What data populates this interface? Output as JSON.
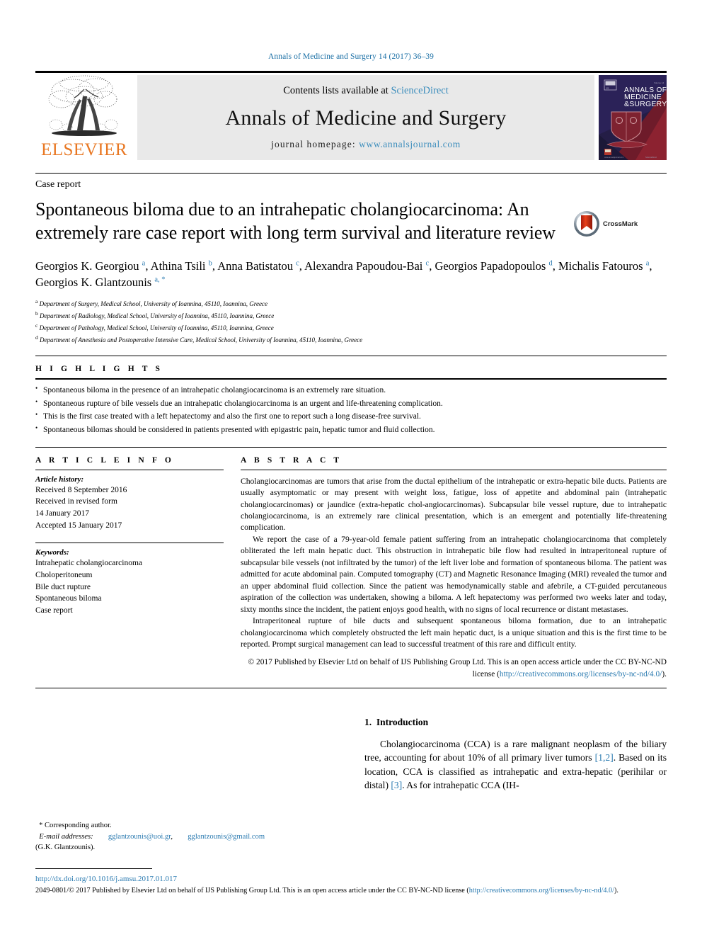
{
  "running_head": "Annals of Medicine and Surgery 14 (2017) 36–39",
  "banner": {
    "publisher_name": "ELSEVIER",
    "contents_prefix": "Contents lists available at ",
    "contents_link": "ScienceDirect",
    "journal_title": "Annals of Medicine and Surgery",
    "homepage_prefix": "journal homepage: ",
    "homepage_url": "www.annalsjournal.com",
    "cover_title_line1": "ANNALS OF",
    "cover_title_line2": "MEDICINE",
    "cover_title_line3": "&SURGERY"
  },
  "article": {
    "type": "Case report",
    "title": "Spontaneous biloma due to an intrahepatic cholangiocarcinoma: An extremely rare case report with long term survival and literature review",
    "crossmark_label": "CrossMark",
    "authors": [
      {
        "name": "Georgios K. Georgiou",
        "sup": "a",
        "sep": ", "
      },
      {
        "name": "Athina Tsili",
        "sup": "b",
        "sep": ", "
      },
      {
        "name": "Anna Batistatou",
        "sup": "c",
        "sep": ", "
      },
      {
        "name": "Alexandra Papoudou-Bai",
        "sup": "c",
        "sep": ", "
      },
      {
        "name": "Georgios Papadopoulos",
        "sup": "d",
        "sep": ", "
      },
      {
        "name": "Michalis Fatouros",
        "sup": "a",
        "sep": ", "
      },
      {
        "name": "Georgios K. Glantzounis",
        "sup": "a, *",
        "sep": ""
      }
    ],
    "affiliations": [
      {
        "mark": "a",
        "text": "Department of Surgery, Medical School, University of Ioannina, 45110, Ioannina, Greece"
      },
      {
        "mark": "b",
        "text": "Department of Radiology, Medical School, University of Ioannina, 45110, Ioannina, Greece"
      },
      {
        "mark": "c",
        "text": "Department of Pathology, Medical School, University of Ioannina, 45110, Ioannina, Greece"
      },
      {
        "mark": "d",
        "text": "Department of Anesthesia and Postoperative Intensive Care, Medical School, University of Ioannina, 45110, Ioannina, Greece"
      }
    ]
  },
  "highlights": {
    "heading": "H I G H L I G H T S",
    "items": [
      "Spontaneous biloma in the presence of an intrahepatic cholangiocarcinoma is an extremely rare situation.",
      "Spontaneous rupture of bile vessels due an intrahepatic cholangiocarcinoma is an urgent and life-threatening complication.",
      "This is the first case treated with a left hepatectomy and also the first one to report such a long disease-free survival.",
      "Spontaneous bilomas should be considered in patients presented with epigastric pain, hepatic tumor and fluid collection."
    ]
  },
  "article_info": {
    "heading": "A R T I C L E   I N F O",
    "history_label": "Article history:",
    "history_lines": [
      "Received 8 September 2016",
      "Received in revised form",
      "14 January 2017",
      "Accepted 15 January 2017"
    ],
    "keywords_label": "Keywords:",
    "keywords": [
      "Intrahepatic cholangiocarcinoma",
      "Choloperitoneum",
      "Bile duct rupture",
      "Spontaneous biloma",
      "Case report"
    ]
  },
  "abstract": {
    "heading": "A B S T R A C T",
    "paragraphs": [
      "Cholangiocarcinomas are tumors that arise from the ductal epithelium of the intrahepatic or extra-hepatic bile ducts. Patients are usually asymptomatic or may present with weight loss, fatigue, loss of appetite and abdominal pain (intrahepatic cholangiocarcinomas) or jaundice (extra-hepatic chol-angiocarcinomas). Subcapsular bile vessel rupture, due to intrahepatic cholangiocarcinoma, is an extremely rare clinical presentation, which is an emergent and potentially life-threatening complication.",
      "We report the case of a 79-year-old female patient suffering from an intrahepatic cholangiocarcinoma that completely obliterated the left main hepatic duct. This obstruction in intrahepatic bile flow had resulted in intraperitoneal rupture of subcapsular bile vessels (not infiltrated by the tumor) of the left liver lobe and formation of spontaneous biloma. The patient was admitted for acute abdominal pain. Computed tomography (CT) and Magnetic Resonance Imaging (MRI) revealed the tumor and an upper abdominal fluid collection. Since the patient was hemodynamically stable and afebrile, a CT-guided percutaneous aspiration of the collection was undertaken, showing a biloma. A left hepatectomy was performed two weeks later and today, sixty months since the incident, the patient enjoys good health, with no signs of local recurrence or distant metastases.",
      "Intraperitoneal rupture of bile ducts and subsequent spontaneous biloma formation, due to an intrahepatic cholangiocarcinoma which completely obstructed the left main hepatic duct, is a unique situation and this is the first time to be reported. Prompt surgical management can lead to successful treatment of this rare and difficult entity."
    ],
    "copyright_text": "© 2017 Published by Elsevier Ltd on behalf of IJS Publishing Group Ltd. This is an open access article under the CC BY-NC-ND license (",
    "copyright_link": "http://creativecommons.org/licenses/by-nc-nd/4.0/",
    "copyright_tail": ")."
  },
  "introduction": {
    "number": "1.",
    "heading": "Introduction",
    "paragraph_part1": "Cholangiocarcinoma (CCA) is a rare malignant neoplasm of the biliary tree, accounting for about 10% of all primary liver tumors ",
    "ref1": "[1,2]",
    "paragraph_part2": ". Based on its location, CCA is classified as intrahepatic and extra-hepatic (perihilar or distal) ",
    "ref2": "[3]",
    "paragraph_part3": ". As for intrahepatic CCA (IH-"
  },
  "footnote": {
    "star": "*",
    "corresponding": "Corresponding author.",
    "email_label": "E-mail addresses:",
    "email1": "gglantzounis@uoi.gr",
    "email_sep": ",",
    "email2": "gglantzounis@gmail.com",
    "attribution": "(G.K. Glantzounis)."
  },
  "page_footer": {
    "doi": "http://dx.doi.org/10.1016/j.amsu.2017.01.017",
    "issn_text": "2049-0801/© 2017 Published by Elsevier Ltd on behalf of IJS Publishing Group Ltd. This is an open access article under the CC BY-NC-ND license (",
    "issn_link": "http://creativecommons.org/licenses/by-nc-nd/4.0/",
    "issn_tail": ")."
  },
  "colors": {
    "link": "#2a7ab0",
    "elsevier_orange": "#e87722",
    "banner_gray": "#e9e9e9",
    "running_head": "#1a6fa5"
  }
}
